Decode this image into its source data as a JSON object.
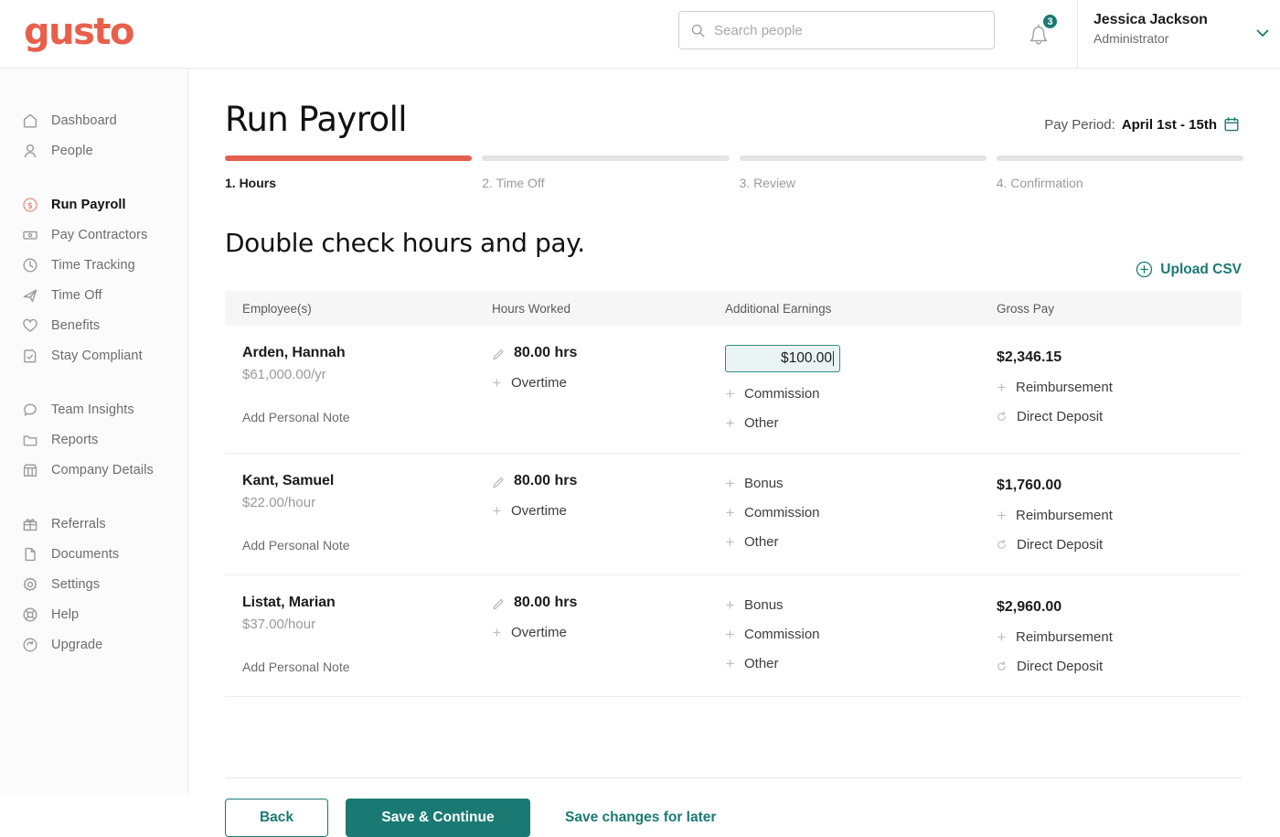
{
  "brand": {
    "logo_text": "gusto",
    "logo_color": "#e8604c",
    "accent_teal": "#1a7a73"
  },
  "topbar": {
    "search": {
      "placeholder": "Search people",
      "value": ""
    },
    "notifications": {
      "count": "3"
    },
    "user": {
      "name": "Jessica Jackson",
      "role": "Administrator"
    }
  },
  "sidebar": {
    "groups": [
      {
        "items": [
          {
            "label": "Dashboard",
            "icon": "home-icon",
            "active": false
          },
          {
            "label": "People",
            "icon": "person-icon",
            "active": false
          }
        ]
      },
      {
        "items": [
          {
            "label": "Run Payroll",
            "icon": "dollar-circle-icon",
            "active": true
          },
          {
            "label": "Pay Contractors",
            "icon": "cash-icon",
            "active": false
          },
          {
            "label": "Time Tracking",
            "icon": "clock-icon",
            "active": false
          },
          {
            "label": "Time Off",
            "icon": "airplane-icon",
            "active": false
          },
          {
            "label": "Benefits",
            "icon": "heart-icon",
            "active": false
          },
          {
            "label": "Stay Compliant",
            "icon": "shield-check-icon",
            "active": false
          }
        ]
      },
      {
        "items": [
          {
            "label": "Team Insights",
            "icon": "chat-bubble-icon",
            "active": false
          },
          {
            "label": "Reports",
            "icon": "folder-icon",
            "active": false
          },
          {
            "label": "Company Details",
            "icon": "storefront-icon",
            "active": false
          }
        ]
      },
      {
        "items": [
          {
            "label": "Referrals",
            "icon": "gift-icon",
            "active": false
          },
          {
            "label": "Documents",
            "icon": "document-icon",
            "active": false
          },
          {
            "label": "Settings",
            "icon": "gear-icon",
            "active": false
          },
          {
            "label": "Help",
            "icon": "lifebuoy-icon",
            "active": false
          },
          {
            "label": "Upgrade",
            "icon": "refresh-circle-icon",
            "active": false
          }
        ]
      }
    ]
  },
  "page": {
    "title": "Run Payroll",
    "pay_period_label": "Pay Period:",
    "pay_period_value": "April 1st - 15th",
    "section_title": "Double check hours and pay.",
    "upload_csv_label": "Upload CSV"
  },
  "steps": [
    {
      "label": "1. Hours",
      "done": true
    },
    {
      "label": "2. Time Off",
      "done": false
    },
    {
      "label": "3. Review",
      "done": false
    },
    {
      "label": "4. Confirmation",
      "done": false
    }
  ],
  "table": {
    "headers": [
      "Employee(s)",
      "Hours Worked",
      "Additional Earnings",
      "Gross Pay"
    ],
    "rows": [
      {
        "name": "Arden, Hannah",
        "rate": "$61,000.00/yr",
        "note_label": "Add Personal Note",
        "hours": "80.00 hrs",
        "hours_actions": [
          "Overtime"
        ],
        "earnings_input": {
          "value": "$100.00",
          "focused": true
        },
        "earnings_actions": [
          "Commission",
          "Other"
        ],
        "gross_pay": "$2,346.15",
        "gross_actions": [
          "Reimbursement",
          "Direct Deposit"
        ]
      },
      {
        "name": "Kant, Samuel",
        "rate": "$22.00/hour",
        "note_label": "Add Personal Note",
        "hours": "80.00 hrs",
        "hours_actions": [
          "Overtime"
        ],
        "earnings_input": null,
        "earnings_actions": [
          "Bonus",
          "Commission",
          "Other"
        ],
        "gross_pay": "$1,760.00",
        "gross_actions": [
          "Reimbursement",
          "Direct Deposit"
        ]
      },
      {
        "name": "Listat, Marian",
        "rate": "$37.00/hour",
        "note_label": "Add Personal Note",
        "hours": "80.00 hrs",
        "hours_actions": [
          "Overtime"
        ],
        "earnings_input": null,
        "earnings_actions": [
          "Bonus",
          "Commission",
          "Other"
        ],
        "gross_pay": "$2,960.00",
        "gross_actions": [
          "Reimbursement",
          "Direct Deposit"
        ]
      }
    ]
  },
  "footer": {
    "back_label": "Back",
    "save_continue_label": "Save & Continue",
    "save_later_label": "Save changes for later"
  }
}
